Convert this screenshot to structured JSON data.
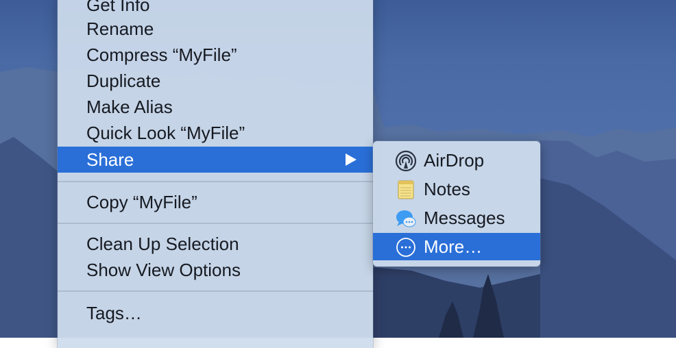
{
  "context_menu": {
    "items": [
      {
        "label": "Get Info"
      },
      {
        "label": "Rename"
      },
      {
        "label": "Compress “MyFile”"
      },
      {
        "label": "Duplicate"
      },
      {
        "label": "Make Alias"
      },
      {
        "label": "Quick Look “MyFile”"
      },
      {
        "label": "Share",
        "state": "highlighted",
        "has_submenu": true
      },
      {
        "label": "Copy “MyFile”"
      },
      {
        "label": "Clean Up Selection"
      },
      {
        "label": "Show View Options"
      },
      {
        "label": "Tags…"
      }
    ]
  },
  "share_submenu": {
    "items": [
      {
        "label": "AirDrop",
        "icon": "airdrop-icon"
      },
      {
        "label": "Notes",
        "icon": "notes-icon"
      },
      {
        "label": "Messages",
        "icon": "messages-icon"
      },
      {
        "label": "More…",
        "icon": "more-icon",
        "state": "highlighted"
      }
    ]
  },
  "colors": {
    "highlight": "#2a6fd8",
    "menu_background": "#cedbec",
    "text": "#161a22"
  }
}
